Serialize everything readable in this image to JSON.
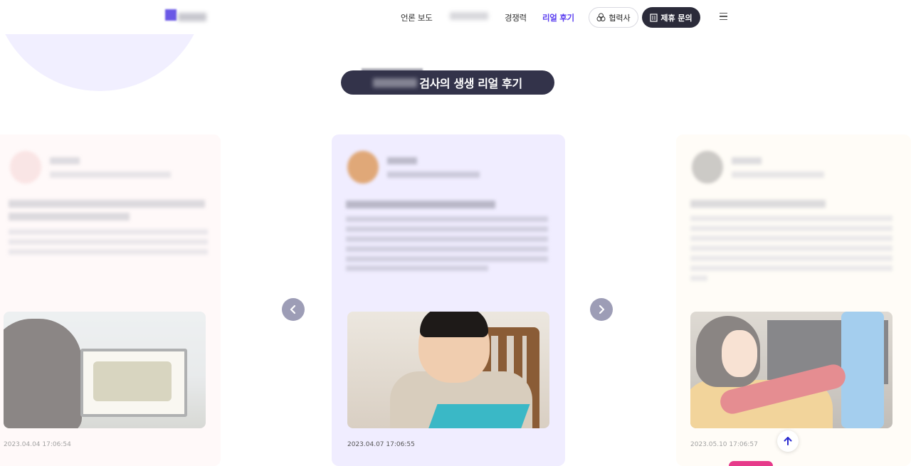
{
  "header": {
    "nav": [
      {
        "label": "언론 보도",
        "active": false
      },
      {
        "label": "경쟁력",
        "active": false
      },
      {
        "label": "리얼 후기",
        "active": true
      }
    ],
    "partner_label": "협력사",
    "contact_label": "제휴 문의"
  },
  "section": {
    "title_suffix": "검사의 생생 리얼 후기"
  },
  "reviews": [
    {
      "date": "2023.04.04 17:06:54"
    },
    {
      "date": "2023.04.07 17:06:55"
    },
    {
      "date": "2023.05.10 17:06:57"
    }
  ],
  "colors": {
    "accent": "#5b3ff0",
    "dark": "#2b2b3a",
    "card_pink": "#fff4f4",
    "card_purple": "#f0edff",
    "card_cream": "#fffaf0"
  },
  "icons": {
    "prev": "chevron-left-icon",
    "next": "chevron-right-icon",
    "menu": "hamburger-icon",
    "scroll_top": "arrow-up-icon"
  }
}
